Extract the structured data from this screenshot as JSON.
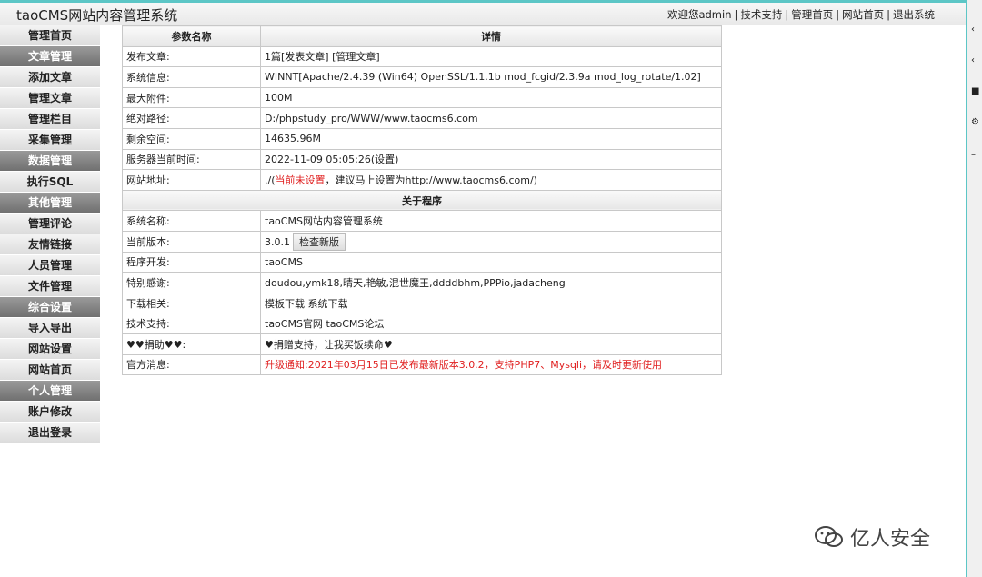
{
  "header": {
    "title": "taoCMS网站内容管理系统",
    "welcome": "欢迎您admin",
    "links": [
      "技术支持",
      "管理首页",
      "网站首页",
      "退出系统"
    ]
  },
  "sidebar": {
    "items": [
      {
        "label": "管理首页",
        "type": "item"
      },
      {
        "label": "文章管理",
        "type": "group"
      },
      {
        "label": "添加文章",
        "type": "item"
      },
      {
        "label": "管理文章",
        "type": "item"
      },
      {
        "label": "管理栏目",
        "type": "item"
      },
      {
        "label": "采集管理",
        "type": "item"
      },
      {
        "label": "数据管理",
        "type": "group"
      },
      {
        "label": "执行SQL",
        "type": "item"
      },
      {
        "label": "其他管理",
        "type": "group"
      },
      {
        "label": "管理评论",
        "type": "item"
      },
      {
        "label": "友情链接",
        "type": "item"
      },
      {
        "label": "人员管理",
        "type": "item"
      },
      {
        "label": "文件管理",
        "type": "item"
      },
      {
        "label": "综合设置",
        "type": "group"
      },
      {
        "label": "导入导出",
        "type": "item"
      },
      {
        "label": "网站设置",
        "type": "item"
      },
      {
        "label": "网站首页",
        "type": "item"
      },
      {
        "label": "个人管理",
        "type": "group"
      },
      {
        "label": "账户修改",
        "type": "item"
      },
      {
        "label": "退出登录",
        "type": "item"
      }
    ]
  },
  "table": {
    "col_param": "参数名称",
    "col_detail": "详情",
    "rows1": {
      "articles": {
        "label": "发布文章:",
        "count": "1篇",
        "publish": "[发表文章]",
        "manage": "[管理文章]"
      },
      "sysinfo": {
        "label": "系统信息:",
        "value": "WINNT[Apache/2.4.39 (Win64) OpenSSL/1.1.1b mod_fcgid/2.3.9a mod_log_rotate/1.02]"
      },
      "attach": {
        "label": "最大附件:",
        "value": "100M"
      },
      "path": {
        "label": "绝对路径:",
        "value": "D:/phpstudy_pro/WWW/www.taocms6.com"
      },
      "space": {
        "label": "剩余空间:",
        "value": "14635.96M"
      },
      "time": {
        "label": "服务器当前时间:",
        "value": "2022-11-09 05:05:26",
        "link": "(设置)"
      },
      "url": {
        "label": "网站地址:",
        "prefix": "./(",
        "warn": "当前未设置",
        "suffix": "，建议马上设置为http://www.taocms6.com/)"
      }
    },
    "about_title": "关于程序",
    "rows2": {
      "name": {
        "label": "系统名称:",
        "value": "taoCMS网站内容管理系统"
      },
      "version": {
        "label": "当前版本:",
        "value": "3.0.1",
        "button": "检查新版"
      },
      "dev": {
        "label": "程序开发:",
        "value": "taoCMS"
      },
      "thanks": {
        "label": "特别感谢:",
        "value": "doudou,ymk18,晴天,艳敏,混世魔王,ddddbhm,PPPio,jadacheng"
      },
      "download": {
        "label": "下载相关:",
        "tpl": "模板下载",
        "sys": "系统下载"
      },
      "support": {
        "label": "技术支持:",
        "site": "taoCMS官网",
        "forum": "taoCMS论坛"
      },
      "donate": {
        "label": "♥♥捐助♥♥:",
        "value": "♥捐赠支持，让我买饭续命♥"
      },
      "news": {
        "label": "官方消息:",
        "value": "升级通知:2021年03月15日已发布最新版本3.0.2，支持PHP7、Mysqli，请及时更新使用"
      }
    }
  },
  "watermark": "亿人安全",
  "colors": {
    "accent": "#5cc6c6",
    "warn": "#e02020",
    "group_bg": "#7a7a7a"
  }
}
